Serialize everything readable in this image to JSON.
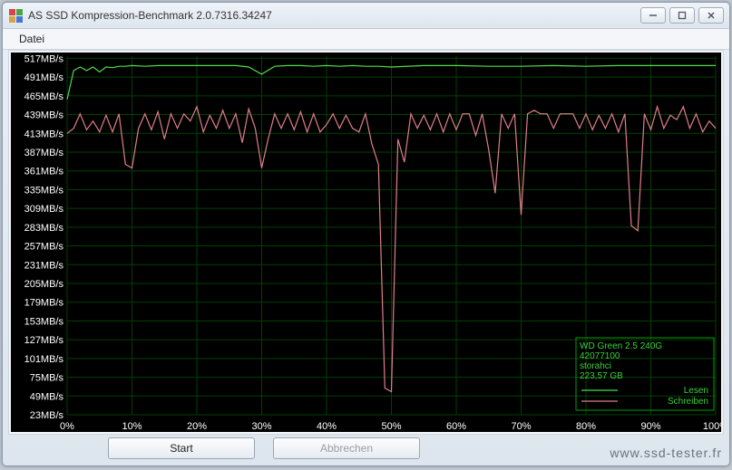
{
  "window": {
    "title": "AS SSD Kompression-Benchmark 2.0.7316.34247",
    "minimize": "─",
    "maximize": "□",
    "close": "✕"
  },
  "menu": {
    "datei": "Datei"
  },
  "buttons": {
    "start": "Start",
    "abort": "Abbrechen"
  },
  "legend": {
    "device": "WD Green 2.5 240G",
    "firmware": "42077100",
    "driver": "storahci",
    "capacity": "223,57 GB",
    "read": "Lesen",
    "write": "Schreiben"
  },
  "watermark": "www.ssd-tester.fr",
  "chart_data": {
    "type": "line",
    "xlabel": "",
    "ylabel": "",
    "x_unit": "%",
    "y_unit": "MB/s",
    "xlim": [
      0,
      100
    ],
    "ylim": [
      23,
      520
    ],
    "y_ticks": [
      517,
      491,
      465,
      439,
      413,
      387,
      361,
      335,
      309,
      283,
      257,
      231,
      205,
      179,
      153,
      127,
      101,
      75,
      49,
      23
    ],
    "x_ticks": [
      0,
      10,
      20,
      30,
      40,
      50,
      60,
      70,
      80,
      90,
      100
    ],
    "y_tick_suffix": "MB/s",
    "x_tick_suffix": "%",
    "series": [
      {
        "name": "Lesen",
        "color": "#4fdc4a",
        "x": [
          0,
          1,
          2,
          3,
          4,
          5,
          6,
          7,
          8,
          9,
          10,
          12,
          14,
          16,
          18,
          20,
          22,
          24,
          26,
          28,
          30,
          32,
          34,
          36,
          38,
          40,
          42,
          44,
          46,
          48,
          50,
          55,
          60,
          65,
          70,
          75,
          80,
          85,
          90,
          95,
          100
        ],
        "values": [
          460,
          500,
          505,
          500,
          505,
          498,
          505,
          504,
          506,
          506,
          507,
          506,
          507,
          507,
          507,
          507,
          507,
          507,
          507,
          505,
          495,
          506,
          507,
          507,
          506,
          507,
          506,
          507,
          506,
          506,
          505,
          507,
          507,
          506,
          506,
          507,
          506,
          507,
          507,
          507,
          507
        ]
      },
      {
        "name": "Schreiben",
        "color": "#e07e8a",
        "x": [
          0,
          1,
          2,
          3,
          4,
          5,
          6,
          7,
          8,
          9,
          10,
          11,
          12,
          13,
          14,
          15,
          16,
          17,
          18,
          19,
          20,
          21,
          22,
          23,
          24,
          25,
          26,
          27,
          28,
          29,
          30,
          31,
          32,
          33,
          34,
          35,
          36,
          37,
          38,
          39,
          40,
          41,
          42,
          43,
          44,
          45,
          46,
          47,
          48,
          49,
          50,
          51,
          52,
          53,
          54,
          55,
          56,
          57,
          58,
          59,
          60,
          61,
          62,
          63,
          64,
          65,
          66,
          67,
          68,
          69,
          70,
          71,
          72,
          73,
          74,
          75,
          76,
          77,
          78,
          79,
          80,
          81,
          82,
          83,
          84,
          85,
          86,
          87,
          88,
          89,
          90,
          91,
          92,
          93,
          94,
          95,
          96,
          97,
          98,
          99,
          100
        ],
        "values": [
          413,
          420,
          440,
          418,
          430,
          415,
          438,
          415,
          440,
          370,
          365,
          420,
          440,
          418,
          443,
          405,
          440,
          420,
          440,
          430,
          450,
          415,
          438,
          420,
          445,
          420,
          440,
          400,
          447,
          420,
          365,
          405,
          440,
          420,
          440,
          418,
          443,
          415,
          440,
          415,
          425,
          440,
          420,
          438,
          420,
          415,
          440,
          398,
          370,
          60,
          55,
          405,
          373,
          440,
          420,
          438,
          418,
          440,
          415,
          440,
          418,
          440,
          440,
          410,
          440,
          390,
          330,
          440,
          420,
          440,
          300,
          440,
          445,
          440,
          440,
          420,
          440,
          440,
          440,
          420,
          440,
          418,
          438,
          420,
          440,
          415,
          440,
          285,
          278,
          440,
          418,
          450,
          420,
          438,
          432,
          450,
          420,
          440,
          415,
          430,
          420
        ]
      }
    ]
  }
}
